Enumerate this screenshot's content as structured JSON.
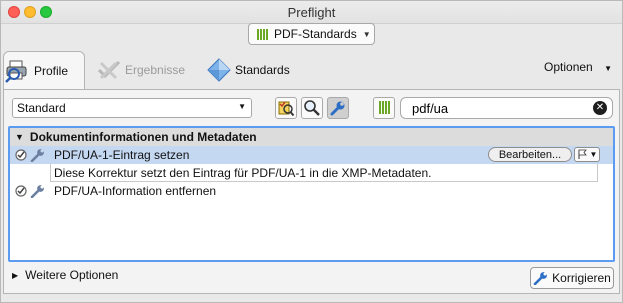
{
  "window": {
    "title": "Preflight"
  },
  "profile_menu": {
    "label": "PDF-Standards"
  },
  "tabs": [
    {
      "label": "Profile",
      "icon": "printer-magnifier-icon",
      "state": "active"
    },
    {
      "label": "Ergebnisse",
      "icon": "results-icon",
      "state": "disabled"
    },
    {
      "label": "Standards",
      "icon": "diamond-icon",
      "state": "normal"
    }
  ],
  "options_menu": {
    "label": "Optionen"
  },
  "toolbar": {
    "category_select": {
      "value": "Standard"
    },
    "search": {
      "value": "pdf/ua"
    },
    "icons": [
      "profile-check-icon",
      "magnifier-icon",
      "wrench-icon",
      "standards-bars-icon"
    ]
  },
  "list": {
    "group_title": "Dokumentinformationen und Metadaten",
    "rows": [
      {
        "label": "PDF/UA-1-Eintrag setzen",
        "selected": true
      },
      {
        "label": "PDF/UA-Information entfernen",
        "selected": false
      }
    ],
    "description": "Diese Korrektur setzt den Eintrag für PDF/UA-1 in die XMP-Metadaten.",
    "edit_button": "Bearbeiten..."
  },
  "footer": {
    "more_options": "Weitere Optionen",
    "fix_button": "Korrigieren"
  },
  "colors": {
    "selection": "#c5d8f2",
    "focus_ring": "#5b9bf2",
    "bars_green": "#6aa826"
  }
}
